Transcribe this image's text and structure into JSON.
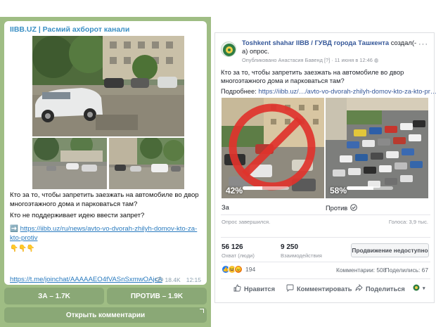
{
  "telegram": {
    "channel": "IIBB.UZ | Расмий ахборот канали",
    "message": {
      "question": "Кто за то, чтобы запретить заезжать на автомобиле во двор многоэтажного дома и парковаться там?",
      "question2": "Кто не поддерживает идею ввести запрет?",
      "arrow_icon": "➡️",
      "link": "https://iibb.uz/ru/news/avto-vo-dvorah-zhilyh-domov-kto-za-kto-protiv",
      "pointing_icons": "👇👇👇",
      "join_link": "https://t.me/joinchat/AAAAAEO4fVASnSxmwOAjcA"
    },
    "views": "18.4K",
    "time": "12:15",
    "buttons": {
      "for": "ЗА – 1.7K",
      "against": "ПРОТИВ – 1.9K",
      "open_comments": "Открыть комментарии"
    },
    "colors": {
      "background": "#9fbd84",
      "button": "#8aa876",
      "link": "#2a7bbf"
    }
  },
  "facebook": {
    "page_name": "Toshkent shahar IIBB / ГУВД города Ташкента",
    "action": "создал(-а) опрос.",
    "published_by": "Опубликовано Анастасия Бавенд",
    "help": "[?]",
    "date": "11 июня в 12:46",
    "text": "Кто за то, чтобы запретить заезжать на автомобиле во двор многоэтажного дома и парковаться там?",
    "more_label": "Подробнее:",
    "more_link": "https://iibb.uz/…/avto-vo-dvorah-zhilyh-domov-kto-za-kto-pr…",
    "poll": [
      {
        "label": "За",
        "percent_text": "42%",
        "percent": 42
      },
      {
        "label": "Против",
        "percent_text": "58%",
        "percent": 58
      }
    ],
    "poll_status": "Опрос завершился.",
    "votes": "Голоса: 3,9 тыс.",
    "reach": {
      "value": "56 126",
      "label": "Охват (люди)"
    },
    "engagement": {
      "value": "9 250",
      "label": "Взаимодействия"
    },
    "promote_button": "Продвижение недоступно",
    "reactions_count": "194",
    "comments": "Комментарии: 508",
    "shares": "Поделились: 67",
    "actions": {
      "like": "Нравится",
      "comment": "Комментировать",
      "share": "Поделиться"
    },
    "colors": {
      "link": "#365899",
      "text": "#1d2129",
      "muted": "#90949c",
      "prohibit": "#e0332c"
    }
  }
}
